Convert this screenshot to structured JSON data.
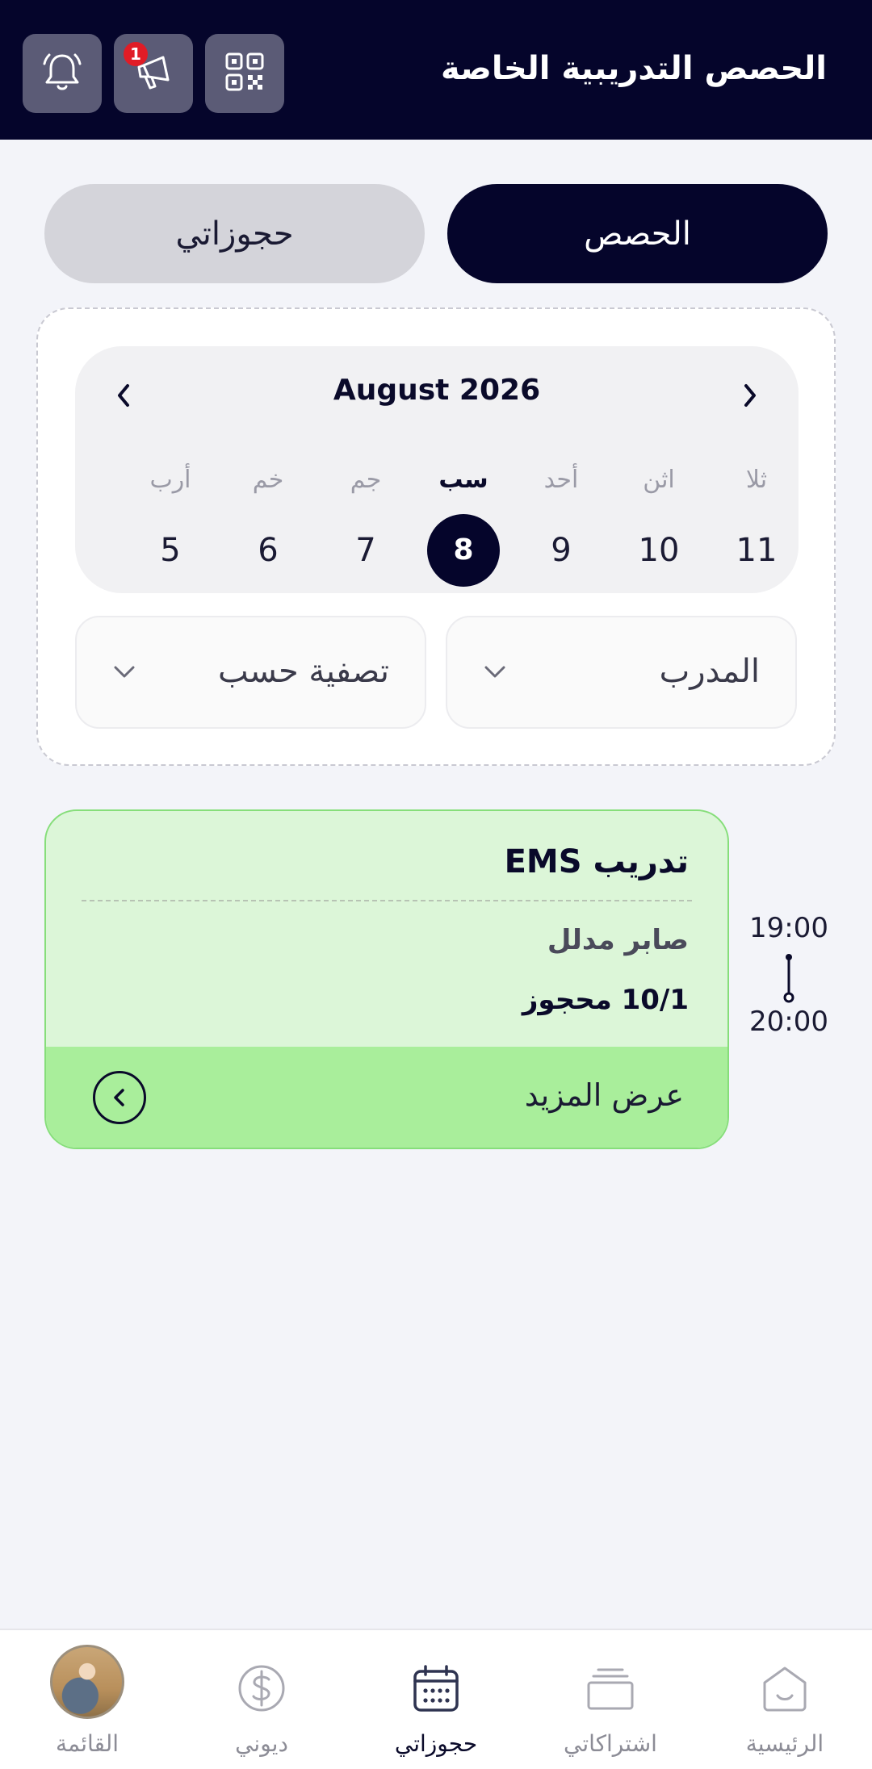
{
  "header": {
    "title": "الحصص التدريبية الخاصة",
    "notification_badge": "1",
    "icons": [
      "bell-icon",
      "megaphone-icon",
      "qr-code-icon"
    ]
  },
  "tabs": {
    "active_label": "الحصص",
    "inactive_label": "حجوزاتي"
  },
  "calendar": {
    "month_label": "August 2026",
    "days": [
      {
        "name": "ثلا",
        "num": "11",
        "selected": false
      },
      {
        "name": "اثن",
        "num": "10",
        "selected": false
      },
      {
        "name": "أحد",
        "num": "9",
        "selected": false
      },
      {
        "name": "سب",
        "num": "8",
        "selected": true
      },
      {
        "name": "جم",
        "num": "7",
        "selected": false
      },
      {
        "name": "خم",
        "num": "6",
        "selected": false
      },
      {
        "name": "أرب",
        "num": "5",
        "selected": false
      }
    ]
  },
  "filters": {
    "trainer_label": "المدرب",
    "filter_label": "تصفية حسب"
  },
  "sessions": [
    {
      "start": "19:00",
      "end": "20:00",
      "title": "تدريب  EMS",
      "trainer": "صابر مدلل",
      "booked": "10/1 محجوز",
      "more_label": "عرض المزيد"
    }
  ],
  "bottom_nav": {
    "items": [
      {
        "label": "الرئيسية",
        "icon": "home-icon"
      },
      {
        "label": "اشتراكاتي",
        "icon": "subscriptions-icon"
      },
      {
        "label": "حجوزاتي",
        "icon": "calendar-icon",
        "active": true
      },
      {
        "label": "ديوني",
        "icon": "dollar-icon"
      },
      {
        "label": "القائمة",
        "icon": "avatar"
      }
    ]
  },
  "colors": {
    "primary": "#05052b",
    "session_bg": "#dcf6d8",
    "session_footer": "#a9ee9b",
    "badge": "#e01c26"
  }
}
